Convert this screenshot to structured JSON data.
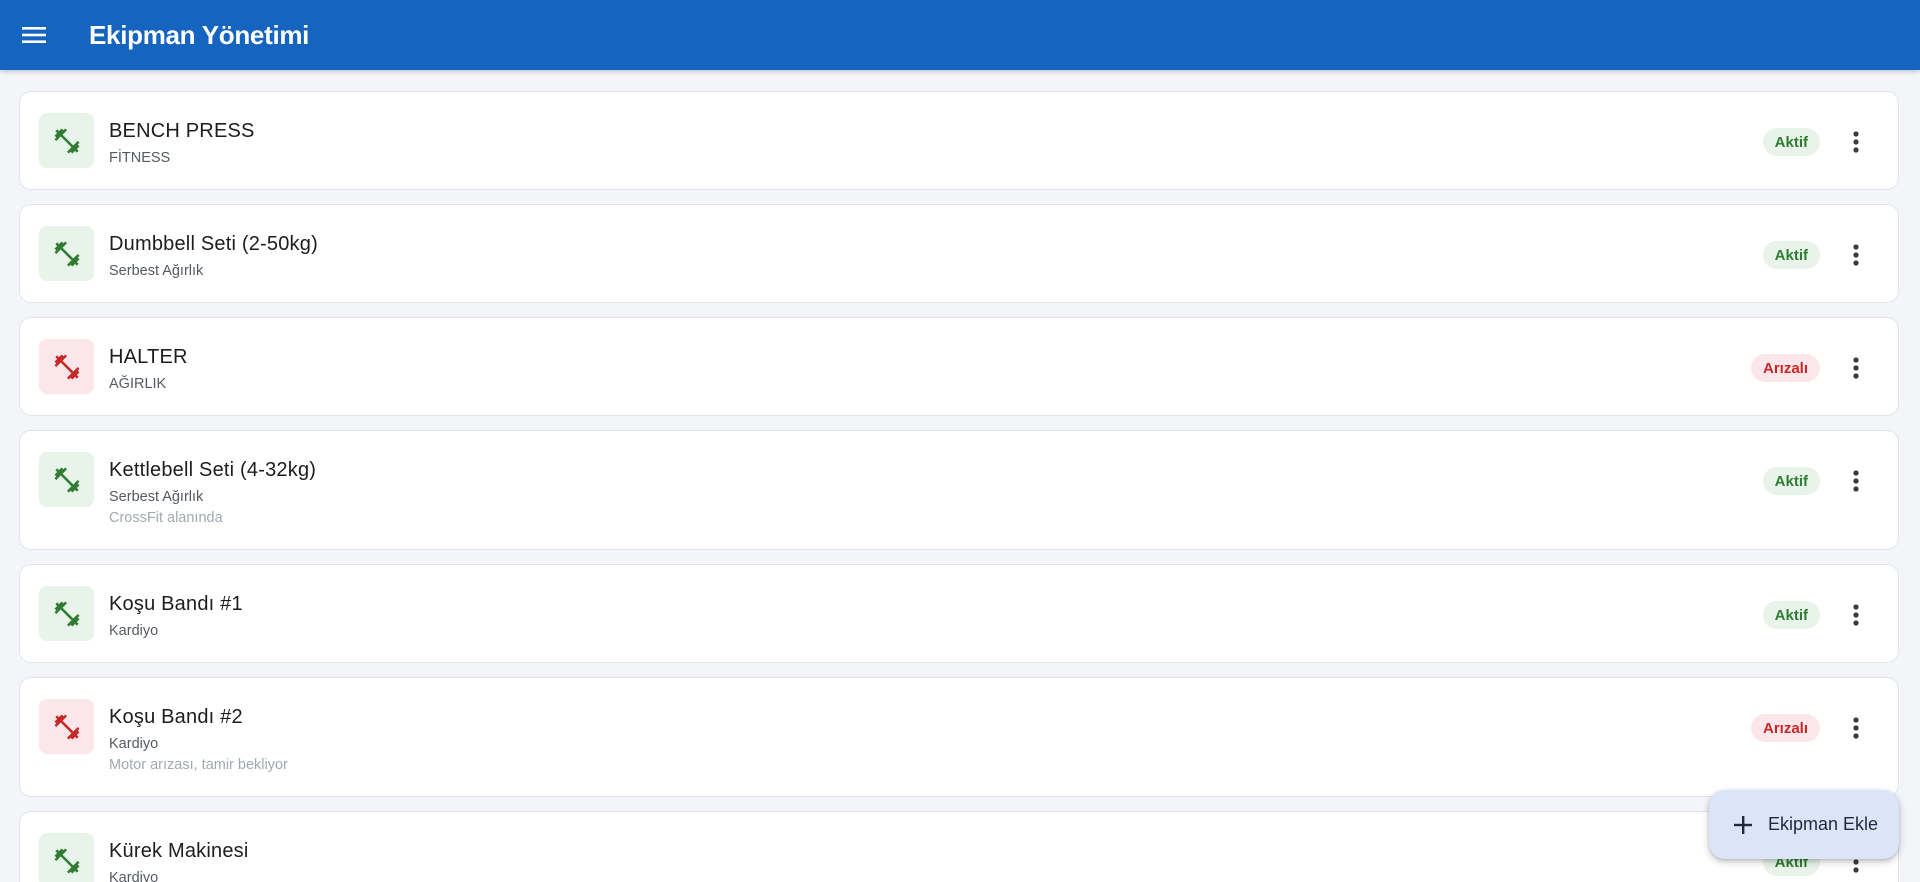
{
  "header": {
    "title": "Ekipman Yönetimi",
    "menu_icon": "menu-icon",
    "background": "#1565c0"
  },
  "equipment": [
    {
      "name": "BENCH PRESS",
      "category": "FİTNESS",
      "note": "",
      "status": "Aktif",
      "state": "ok",
      "icon": "fitness-icon"
    },
    {
      "name": "Dumbbell Seti (2-50kg)",
      "category": "Serbest Ağırlık",
      "note": "",
      "status": "Aktif",
      "state": "ok",
      "icon": "fitness-icon"
    },
    {
      "name": "HALTER",
      "category": "AĞIRLIK",
      "note": "",
      "status": "Arızalı",
      "state": "bad",
      "icon": "fitness-icon"
    },
    {
      "name": "Kettlebell Seti (4-32kg)",
      "category": "Serbest Ağırlık",
      "note": "CrossFit alanında",
      "status": "Aktif",
      "state": "ok",
      "icon": "fitness-icon"
    },
    {
      "name": "Koşu Bandı #1",
      "category": "Kardiyo",
      "note": "",
      "status": "Aktif",
      "state": "ok",
      "icon": "fitness-icon"
    },
    {
      "name": "Koşu Bandı #2",
      "category": "Kardiyo",
      "note": "Motor arızası, tamir bekliyor",
      "status": "Arızalı",
      "state": "bad",
      "icon": "fitness-icon"
    },
    {
      "name": "Kürek Makinesi",
      "category": "Kardiyo",
      "note": "",
      "status": "Aktif",
      "state": "ok",
      "icon": "fitness-icon"
    }
  ],
  "fab": {
    "label": "Ekipman Ekle",
    "icon": "plus-icon"
  },
  "colors": {
    "active_text": "#2e7d32",
    "active_bg": "#e8f3ea",
    "faulty_text": "#c62828",
    "faulty_bg": "#fbe7e9"
  }
}
